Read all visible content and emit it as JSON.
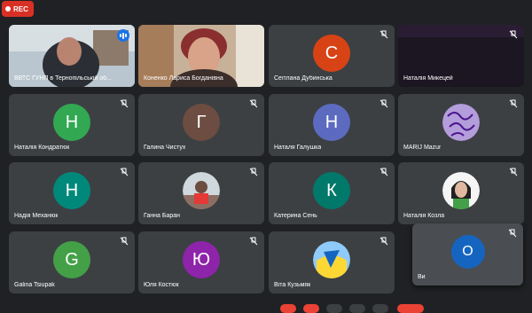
{
  "recording": {
    "label": "REC"
  },
  "tiles": [
    {
      "name": "ВВТС ГУНП в Тернопільській об...",
      "type": "video",
      "speaking": true
    },
    {
      "name": "Коненко Лариса Богданівна",
      "type": "video"
    },
    {
      "name": "Сеітлана Дубинська",
      "initial": "С",
      "color": "#d84315",
      "muted": true
    },
    {
      "name": "Наталія Микецей",
      "type": "dark",
      "muted": true
    },
    {
      "name": "Наталія Кондратюк",
      "initial": "Н",
      "color": "#33a852",
      "muted": true
    },
    {
      "name": "Галина Чистух",
      "initial": "Г",
      "color": "#6d4c41",
      "muted": true
    },
    {
      "name": "Наталя Галушка",
      "initial": "Н",
      "color": "#5c6bc0",
      "muted": true
    },
    {
      "name": "MARIJ Mazur",
      "type": "pattern",
      "muted": true
    },
    {
      "name": "Надія Механюк",
      "initial": "Н",
      "color": "#00897b",
      "muted": true
    },
    {
      "name": "Ганна Баран",
      "type": "photo",
      "muted": true
    },
    {
      "name": "Катерина Сень",
      "initial": "К",
      "color": "#00796b",
      "muted": true
    },
    {
      "name": "Наталія Козла",
      "type": "photo2",
      "muted": true
    },
    {
      "name": "Galina Tsiupak",
      "initial": "G",
      "color": "#43a047",
      "muted": true
    },
    {
      "name": "Юля Костюк",
      "initial": "Ю",
      "color": "#8e24aa",
      "muted": true
    },
    {
      "name": "Віта Кузьмяк",
      "type": "flag",
      "muted": true
    },
    {
      "name": "Ви",
      "initial": "O",
      "color": "#1565c0",
      "muted": true,
      "self": true
    }
  ]
}
